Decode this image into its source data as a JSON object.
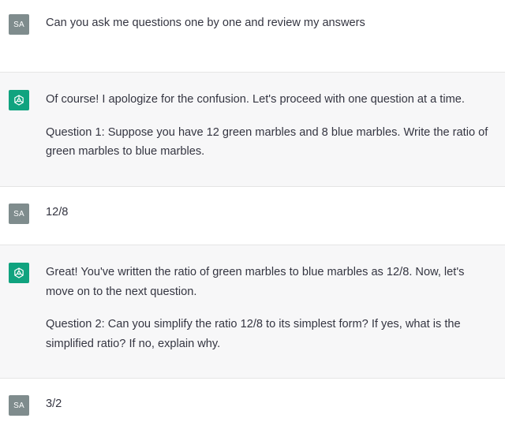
{
  "colors": {
    "user_bg": "#ffffff",
    "assistant_bg": "#f7f7f8",
    "text": "#343541",
    "user_avatar_bg": "#7f8c8d",
    "assistant_avatar_bg": "#10a37f",
    "divider": "#e5e5e5"
  },
  "conversation": {
    "user_initials": "SA",
    "messages": [
      {
        "role": "user",
        "paragraphs": [
          "Can you ask me questions one by one and review my answers"
        ]
      },
      {
        "role": "assistant",
        "icon": "openai-logo-icon",
        "paragraphs": [
          "Of course! I apologize for the confusion. Let's proceed with one question at a time.",
          "Question 1: Suppose you have 12 green marbles and 8 blue marbles. Write the ratio of green marbles to blue marbles."
        ]
      },
      {
        "role": "user",
        "paragraphs": [
          "12/8"
        ]
      },
      {
        "role": "assistant",
        "icon": "openai-logo-icon",
        "paragraphs": [
          "Great! You've written the ratio of green marbles to blue marbles as 12/8. Now, let's move on to the next question.",
          "Question 2: Can you simplify the ratio 12/8 to its simplest form? If yes, what is the simplified ratio? If no, explain why."
        ]
      },
      {
        "role": "user",
        "paragraphs": [
          "3/2"
        ]
      }
    ]
  }
}
